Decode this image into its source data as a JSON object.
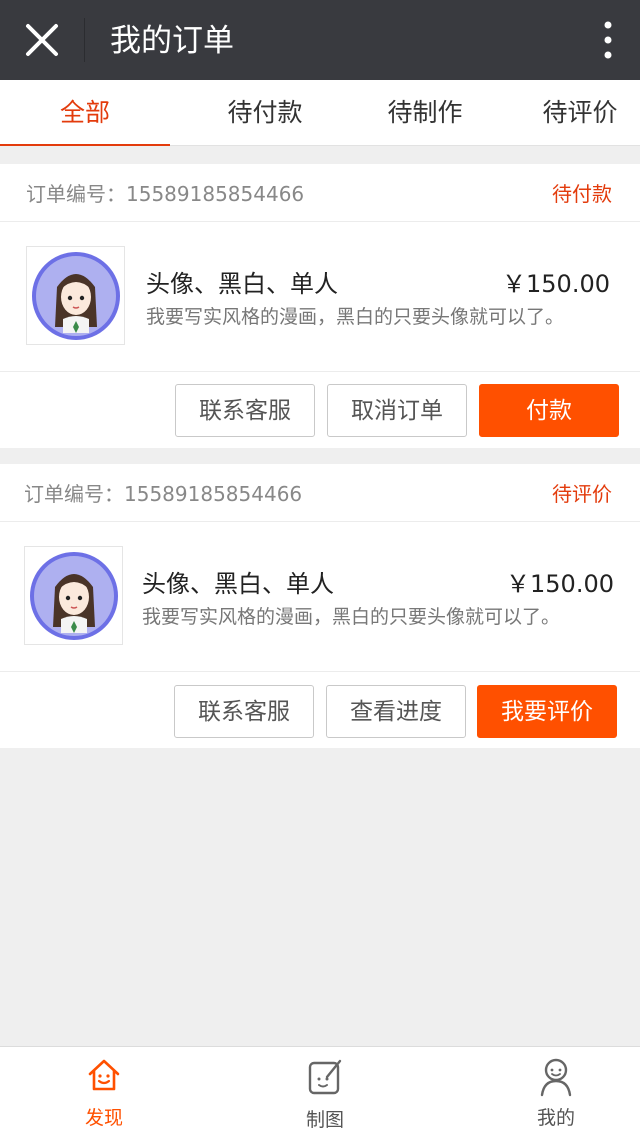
{
  "header": {
    "title": "我的订单",
    "close_icon": "close-icon",
    "more_icon": "more-vertical-icon"
  },
  "tabs": [
    {
      "label": "全部",
      "active": true
    },
    {
      "label": "待付款",
      "active": false
    },
    {
      "label": "待制作",
      "active": false
    },
    {
      "label": "待评价",
      "active": false
    }
  ],
  "orders": [
    {
      "order_label": "订单编号：15589185854466",
      "status": "待付款",
      "product_name": "头像、黑白、单人",
      "price": "￥150.00",
      "description": "我要写实风格的漫画，黑白的只要头像就可以了。",
      "buttons": [
        "联系客服",
        "取消订单",
        "付款"
      ]
    },
    {
      "order_label": "订单编号：15589185854466",
      "status": "待评价",
      "product_name": "头像、黑白、单人",
      "price": "￥150.00",
      "description": "我要写实风格的漫画，黑白的只要头像就可以了。",
      "buttons": [
        "联系客服",
        "查看进度",
        "我要评价"
      ]
    }
  ],
  "bottom_nav": [
    {
      "label": "发现",
      "icon": "home-smile-icon",
      "active": true
    },
    {
      "label": "制图",
      "icon": "draw-icon",
      "active": false
    },
    {
      "label": "我的",
      "icon": "user-icon",
      "active": false
    }
  ],
  "colors": {
    "accent": "#ff5000",
    "accent_text": "#e33b0c",
    "topbar": "#393a3f",
    "background": "#efefef"
  }
}
